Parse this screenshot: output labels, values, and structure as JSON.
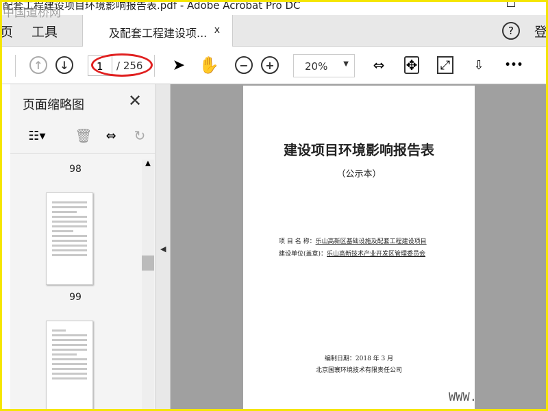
{
  "window": {
    "title": "配套工程建设项目环境影响报告表.pdf - Adobe Acrobat Pro DC",
    "watermark": "中国道桥网"
  },
  "tabs": {
    "home": "页",
    "tools": "工具",
    "document": "及配套工程建设项...",
    "close": "x",
    "help": "?",
    "signin": "登"
  },
  "toolbar": {
    "page_current": "1",
    "page_total": "/ 256",
    "zoom": "20%",
    "more": "•••"
  },
  "thumbnails": {
    "title": "页面缩略图",
    "pages": [
      "98",
      "99"
    ]
  },
  "document": {
    "title": "建设项目环境影响报告表",
    "subtitle": "（公示本）",
    "project_label": "项 目 名 称：",
    "project_name": "乐山高新区基础设施及配套工程建设项目",
    "unit_label": "建设单位(盖章)：",
    "unit_name": "乐山高新技术产业开发区管理委员会",
    "date": "编制日期：2018 年 3 月",
    "company": "北京国寰环境技术有限责任公司"
  },
  "watermark_bottom": "WWW."
}
